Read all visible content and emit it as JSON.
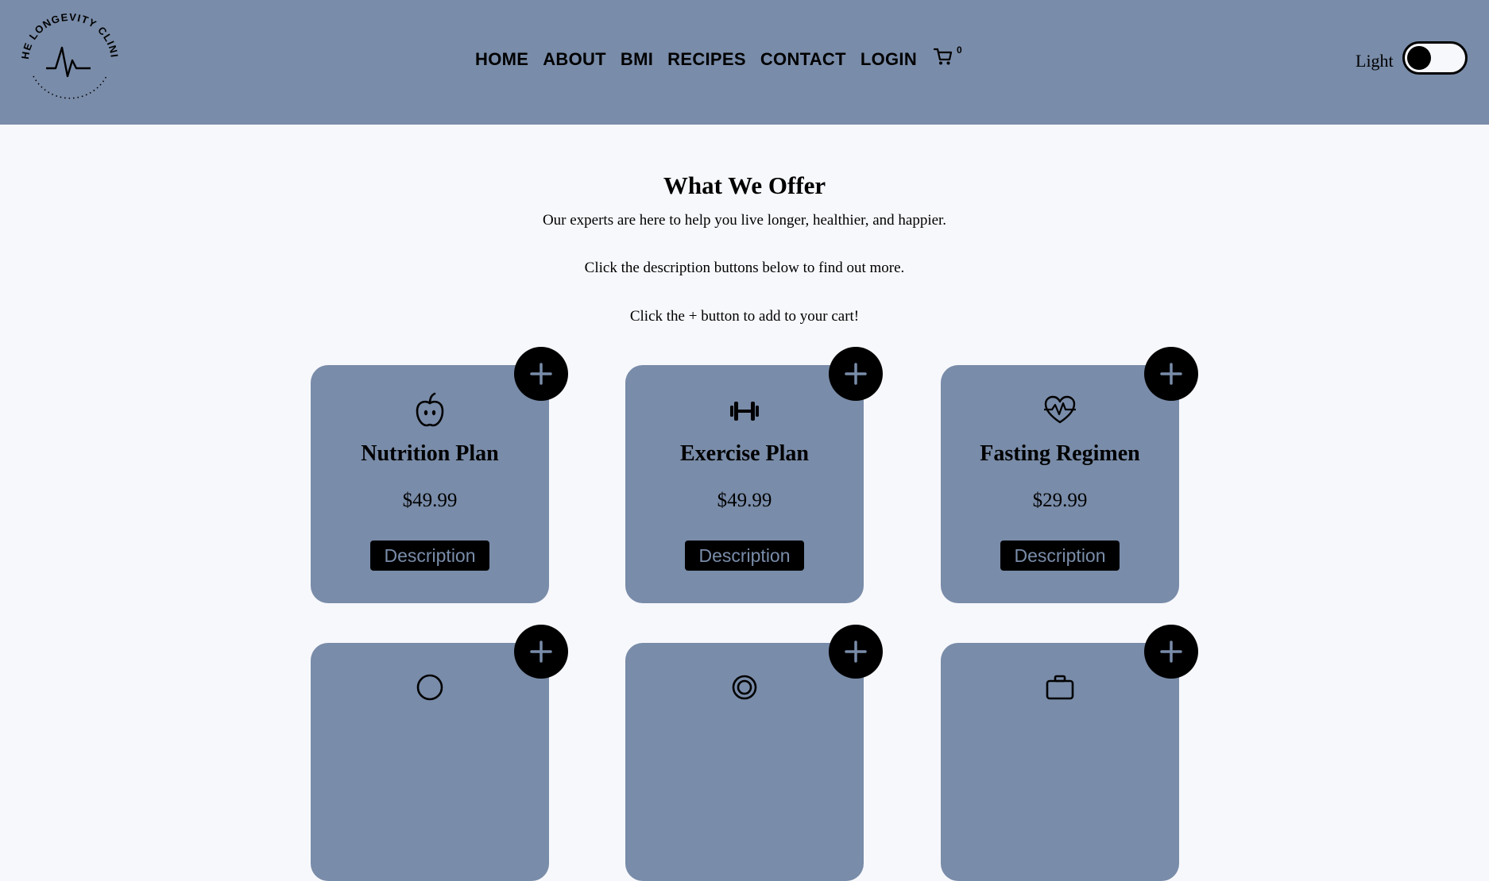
{
  "header": {
    "logo_text": "THE LONGEVITY CLINIC",
    "nav": [
      "HOME",
      "ABOUT",
      "BMI",
      "RECIPES",
      "CONTACT",
      "LOGIN"
    ],
    "cart_icon": "cart-icon",
    "cart_count": "0",
    "theme_label": "Light",
    "theme_toggle": "dark-mode-toggle"
  },
  "intro": {
    "title": "What We Offer",
    "line1": "Our experts are here to help you live longer, healthier, and happier.",
    "line2": "Click the description buttons below to find out more.",
    "line3": "Click the + button to add to your cart!"
  },
  "cards": [
    {
      "icon": "apple-icon",
      "title": "Nutrition Plan",
      "price": "$49.99",
      "button": "Description",
      "add": "+"
    },
    {
      "icon": "dumbbell-icon",
      "title": "Exercise Plan",
      "price": "$49.99",
      "button": "Description",
      "add": "+"
    },
    {
      "icon": "heartbeat-icon",
      "title": "Fasting Regimen",
      "price": "$29.99",
      "button": "Description",
      "add": "+"
    },
    {
      "icon": "moon-icon",
      "add": "+"
    },
    {
      "icon": "target-icon",
      "add": "+"
    },
    {
      "icon": "briefcase-icon",
      "add": "+"
    }
  ],
  "colors": {
    "header_bg": "#798ca9",
    "page_bg": "#f7f8fc",
    "card_bg": "#798ca9",
    "button_bg": "#000000"
  }
}
